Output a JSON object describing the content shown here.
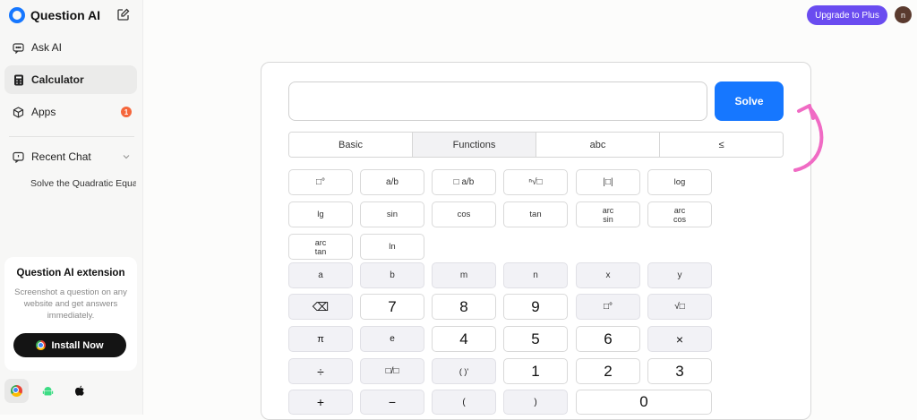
{
  "app": {
    "brand": "Question AI",
    "upgrade_label": "Upgrade to Plus",
    "avatar_initial": "n"
  },
  "sidebar": {
    "items": [
      {
        "label": "Ask AI",
        "icon": "chat-bubble-icon"
      },
      {
        "label": "Calculator",
        "icon": "calculator-icon",
        "active": true
      },
      {
        "label": "Apps",
        "icon": "cube-icon",
        "badge": "1"
      }
    ],
    "recent": {
      "label": "Recent Chat",
      "items": [
        "Solve the Quadratic Equati"
      ]
    }
  },
  "extension": {
    "title": "Question AI extension",
    "description": "Screenshot a question on any website and get answers immediately.",
    "install_label": "Install Now",
    "platforms": [
      "chrome-icon",
      "android-icon",
      "apple-icon"
    ]
  },
  "calculator": {
    "input_value": "",
    "input_placeholder": "",
    "solve_label": "Solve",
    "tabs": [
      "Basic",
      "Functions",
      "abc",
      "≤"
    ],
    "active_tab": "Functions",
    "function_keys": {
      "row1": [
        "□°",
        "a/b",
        "□ a/b",
        "ⁿ√□",
        "|□|",
        "log"
      ],
      "row2": [
        "lg",
        "sin",
        "cos",
        "tan",
        "arc sin",
        "arc cos"
      ],
      "row3": [
        "arc tan",
        "ln"
      ]
    },
    "variables": [
      "a",
      "b",
      "m",
      "n",
      "x",
      "y"
    ],
    "pad": {
      "row1": [
        "⌫",
        "7",
        "8",
        "9",
        "□°",
        "√□"
      ],
      "row2": [
        "π",
        "e",
        "4",
        "5",
        "6",
        "×"
      ],
      "row3": [
        "÷",
        "□/□",
        "( )'",
        "1",
        "2",
        "3"
      ],
      "row4": [
        "+",
        "−",
        "(",
        ")",
        "0"
      ]
    }
  },
  "colors": {
    "accent": "#1677ff",
    "upgrade": "#6a4cf0",
    "badge": "#f5663b",
    "annotation_arrow": "#f06bc4"
  }
}
